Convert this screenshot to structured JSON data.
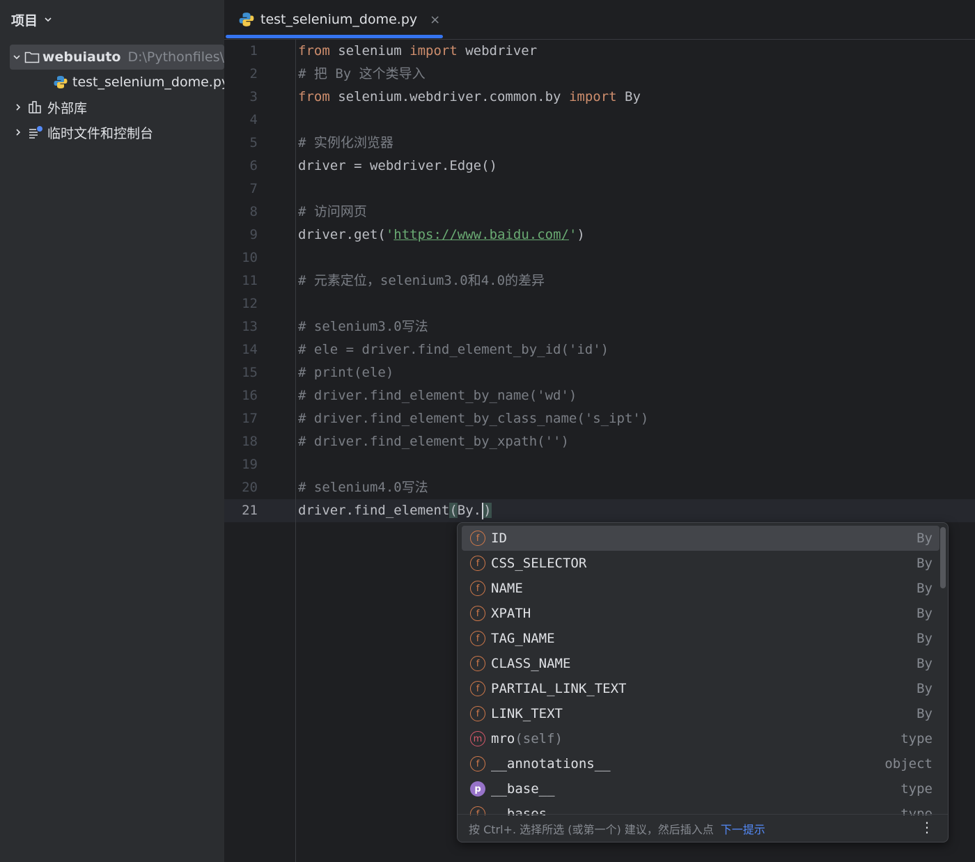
{
  "sidebar": {
    "title": "项目",
    "tree": [
      {
        "label": "webuiauto",
        "path": "D:\\Pythonfiles\\",
        "icon": "folder-icon"
      },
      {
        "label": "test_selenium_dome.py",
        "icon": "python-file-icon"
      },
      {
        "label": "外部库",
        "icon": "library-icon"
      },
      {
        "label": "临时文件和控制台",
        "icon": "scratches-icon"
      }
    ]
  },
  "tab": {
    "label": "test_selenium_dome.py",
    "close": "×"
  },
  "editor": {
    "line_numbers": [
      "1",
      "2",
      "3",
      "4",
      "5",
      "6",
      "7",
      "8",
      "9",
      "10",
      "11",
      "12",
      "13",
      "14",
      "15",
      "16",
      "17",
      "18",
      "19",
      "20",
      "21"
    ],
    "lines": {
      "l1": [
        "from",
        " selenium ",
        "import",
        " webdriver"
      ],
      "l2": "# 把 By 这个类导入",
      "l3": [
        "from",
        " selenium.webdriver.common.by ",
        "import",
        " By"
      ],
      "l5": "# 实例化浏览器",
      "l6": "driver = webdriver.Edge()",
      "l8": "# 访问网页",
      "l9": [
        "driver.get(",
        "'",
        "https://www.baidu.com/",
        "'",
        ")"
      ],
      "l11": "# 元素定位，selenium3.0和4.0的差异",
      "l13": "# selenium3.0写法",
      "l14": "# ele = driver.find_element_by_id('id')",
      "l15": "# print(ele)",
      "l16": "# driver.find_element_by_name('wd')",
      "l17": "# driver.find_element_by_class_name('s_ipt')",
      "l18": "# driver.find_element_by_xpath('')",
      "l20": "# selenium4.0写法",
      "l21": [
        "driver.find_element",
        "(",
        "By.",
        ")"
      ]
    }
  },
  "completion": {
    "items": [
      {
        "kind": "f",
        "name": "ID",
        "params": "",
        "type": "By"
      },
      {
        "kind": "f",
        "name": "CSS_SELECTOR",
        "params": "",
        "type": "By"
      },
      {
        "kind": "f",
        "name": "NAME",
        "params": "",
        "type": "By"
      },
      {
        "kind": "f",
        "name": "XPATH",
        "params": "",
        "type": "By"
      },
      {
        "kind": "f",
        "name": "TAG_NAME",
        "params": "",
        "type": "By"
      },
      {
        "kind": "f",
        "name": "CLASS_NAME",
        "params": "",
        "type": "By"
      },
      {
        "kind": "f",
        "name": "PARTIAL_LINK_TEXT",
        "params": "",
        "type": "By"
      },
      {
        "kind": "f",
        "name": "LINK_TEXT",
        "params": "",
        "type": "By"
      },
      {
        "kind": "m",
        "name": "mro",
        "params": "(self)",
        "type": "type"
      },
      {
        "kind": "f",
        "name": "__annotations__",
        "params": "",
        "type": "object"
      },
      {
        "kind": "p",
        "name": "__base__",
        "params": "",
        "type": "type"
      },
      {
        "kind": "f",
        "name": "__bases__",
        "params": "",
        "type": "type"
      }
    ],
    "footer_hint": "按 Ctrl+. 选择所选 (或第一个) 建议，然后插入点",
    "footer_link": "下一提示",
    "more": "⋮"
  },
  "colors": {
    "accent": "#3574f0",
    "keyword": "#cf8e6d",
    "comment": "#7a7e85",
    "string": "#6aab73"
  }
}
